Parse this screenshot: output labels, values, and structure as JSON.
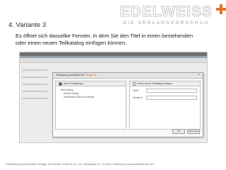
{
  "logo": {
    "word": "EDELWEISS",
    "tagline": "DIE VERLAGSVORSCHAU",
    "accent": "#e3742a"
  },
  "slide": {
    "heading": "4. Variante 3",
    "description": "Es öffnet sich dasselbe Fenster, in dem Sie den Titel in einen bestehenden oder einen neuen Teilkatalog einfügen können."
  },
  "dialog": {
    "title_prefix": "Teilkatalog auswählen für ",
    "title_highlight": "Flunger III",
    "left_option": "Bereit Teilkataloge",
    "left_items": [
      "Neu/Katalog",
      "Herbst-Katalog",
      "Weihnachts-Aktion Sonderheft"
    ],
    "right_option": "Einen neuen Teilkatalog anlegen",
    "fields": [
      {
        "label": "Name"
      },
      {
        "label": "Übersicht"
      }
    ],
    "ok_label": "OK",
    "cancel_label": "Abbrechen"
  },
  "footer": {
    "text": "Hanseberg Kommunikation Verlags- und Medien GmbH & Co. KG • Königswall 21 • D-44137 Dortmund | www.edelweiss-de.com"
  },
  "colors": {
    "highlight": "#d25d1a"
  }
}
